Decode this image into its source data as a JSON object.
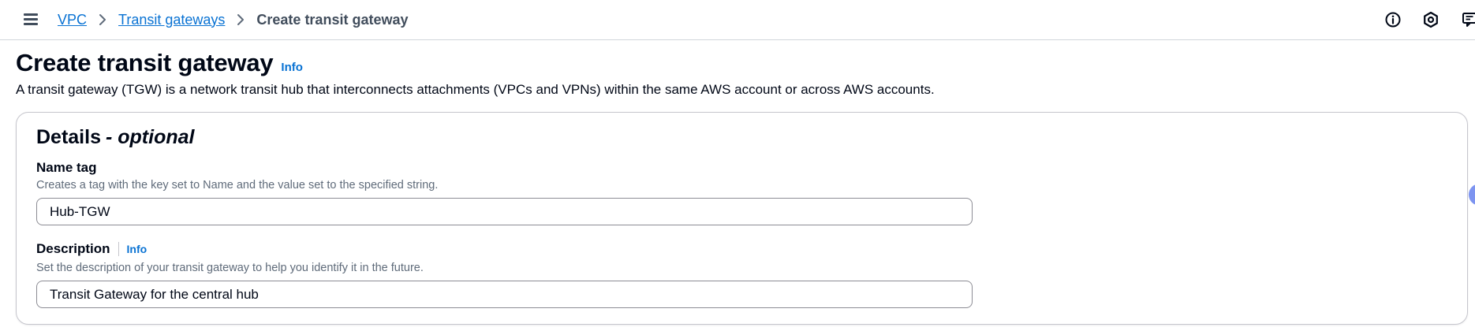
{
  "topbar": {
    "breadcrumb": [
      {
        "label": "VPC"
      },
      {
        "label": "Transit gateways"
      },
      {
        "label": "Create transit gateway"
      }
    ],
    "icons": [
      "info-icon",
      "settings-icon",
      "feedback-icon"
    ]
  },
  "page": {
    "title": "Create transit gateway",
    "info_label": "Info",
    "description": "A transit gateway (TGW) is a network transit hub that interconnects attachments (VPCs and VPNs) within the same AWS account or across AWS accounts."
  },
  "details": {
    "title": "Details",
    "optional": "- optional",
    "name_tag": {
      "label": "Name tag",
      "description": "Creates a tag with the key set to Name and the value set to the specified string.",
      "value": "Hub-TGW"
    },
    "description_field": {
      "label": "Description",
      "info_label": "Info",
      "description": "Set the description of your transit gateway to help you identify it in the future.",
      "value": "Transit Gateway for the central hub"
    }
  },
  "colors": {
    "link": "#0972d3",
    "text": "#000716",
    "secondary_text": "#5f6b7a",
    "border": "#8c8c94",
    "side_bubble": "#7d94f0"
  }
}
